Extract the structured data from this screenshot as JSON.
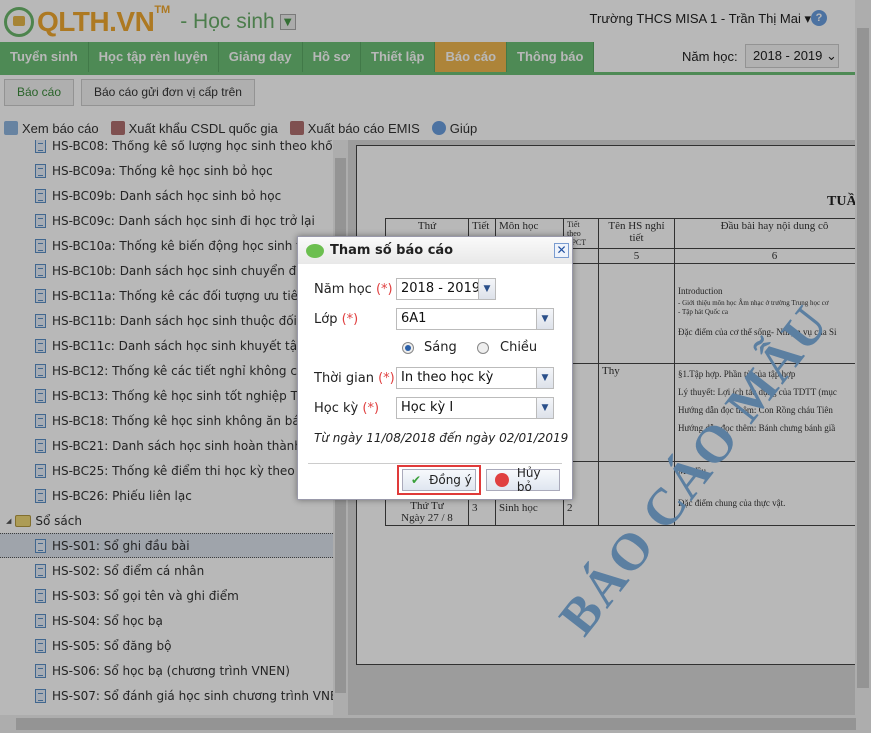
{
  "header": {
    "logo": "QLTH.VN",
    "logo_tm": "TM",
    "module": "- Học sinh",
    "user": "Trường THCS MISA 1 - Trần Thị Mai ▾"
  },
  "nav": {
    "tabs": [
      "Tuyển sinh",
      "Học tập rèn luyện",
      "Giảng dạy",
      "Hồ sơ",
      "Thiết lập",
      "Báo cáo",
      "Thông báo"
    ],
    "active": "Báo cáo",
    "year_label": "Năm học:",
    "year_value": "2018 - 2019"
  },
  "subtabs": [
    "Báo cáo",
    "Báo cáo gửi đơn vị cấp trên"
  ],
  "toolbar": [
    "Xem báo cáo",
    "Xuất khẩu CSDL quốc gia",
    "Xuất báo cáo EMIS",
    "Giúp"
  ],
  "tree": {
    "items": [
      "HS-BC08: Thống kê số lượng học sinh theo khối",
      "HS-BC09a: Thống kê học sinh bỏ học",
      "HS-BC09b: Danh sách học sinh bỏ học",
      "HS-BC09c: Danh sách học sinh đi học trở lại",
      "HS-BC10a: Thống kê biến động học sinh toàn trường",
      "HS-BC10b: Danh sách học sinh chuyển đi, chuyển đến",
      "HS-BC11a: Thống kê các đối tượng ưu tiên, chính sách",
      "HS-BC11b: Danh sách học sinh thuộc đối tượng",
      "HS-BC11c: Danh sách học sinh khuyết tật",
      "HS-BC12: Thống kê các tiết nghỉ không có nguyên",
      "HS-BC13: Thống kê học sinh tốt nghiệp THCS",
      "HS-BC18: Thống kê học sinh không ăn bán trú",
      "HS-BC21: Danh sách học sinh hoàn thành chương",
      "HS-BC25: Thống kê điểm thi học kỳ theo khoảng",
      "HS-BC26: Phiếu liên lạc"
    ],
    "folder": "Sổ sách",
    "folder_items": [
      "HS-S01: Sổ ghi đầu bài",
      "HS-S02: Sổ điểm cá nhân",
      "HS-S03: Sổ gọi tên và ghi điểm",
      "HS-S04: Sổ học bạ",
      "HS-S05: Sổ đăng bộ",
      "HS-S06: Sổ học bạ (chương trình VNEN)",
      "HS-S07: Sổ đánh giá học sinh chương trình VNEN"
    ],
    "selected": "HS-S01: Sổ ghi đầu bài"
  },
  "preview": {
    "title": "TUẦ",
    "headers": [
      "Thứ",
      "Tiết",
      "Môn học",
      "Tiết theo PPCT",
      "Tên HS nghỉ tiết",
      "Đầu bài hay nội dung cô"
    ],
    "numbers": [
      "4",
      "5",
      "6"
    ],
    "rows": [
      "Introduction",
      "- Giới thiệu môn học Âm nhạc ở trường Trung học cơ",
      "- Tập hát Quốc ca",
      "Đặc điểm của cơ thể sống- Nhiệm vụ của Si",
      "§1.Tập hợp. Phần tử của tập hợp",
      "Lý thuyết: Lợi ích tác dụng của TDTT (mục",
      "Hướng dẫn đọc thêm: Con Rồng cháu Tiên",
      "Hướng dẫn đọc thêm: Bánh chưng bánh giầ",
      "Mở đầu",
      "Đặc điểm chung của thực vật."
    ],
    "absent": "Thy",
    "day": "Thứ Tư",
    "date": "Ngày 27 / 8",
    "period": "3",
    "subject": "Sinh học",
    "ppct": "2",
    "watermark": "BÁO CÁO MẪU"
  },
  "dialog": {
    "title": "Tham số báo cáo",
    "required": "(*)",
    "fields": {
      "year_label": "Năm học",
      "year": "2018 - 2019",
      "class_label": "Lớp",
      "class": "6A1",
      "morning": "Sáng",
      "afternoon": "Chiều",
      "time_label": "Thời gian",
      "time": "In theo học kỳ",
      "term_label": "Học kỳ",
      "term": "Học kỳ I"
    },
    "range": "Từ ngày 11/08/2018 đến ngày 02/01/2019",
    "ok": "Đồng ý",
    "cancel": "Hủy bỏ",
    "shift_selected": "Sáng"
  },
  "colors": {
    "nav_green": "#6cbf76",
    "active_tab": "#f0b850",
    "logo": "#f0a830",
    "highlight": "#e03a3a"
  }
}
